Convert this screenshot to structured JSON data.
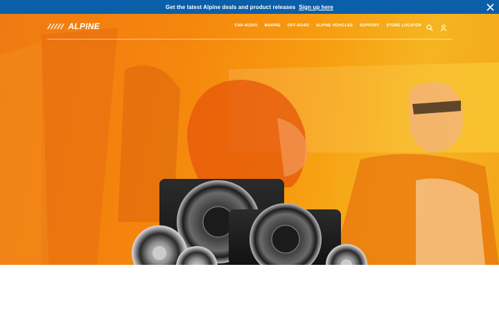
{
  "promo": {
    "text": "Get the latest Alpine deals and product releases",
    "link": "Sign up here",
    "close_icon": "close-icon"
  },
  "brand": {
    "name": "ALPINE",
    "logo": "alpine-logo"
  },
  "nav": {
    "items": [
      {
        "label": "CAR AUDIO"
      },
      {
        "label": "MARINE"
      },
      {
        "label": "OFF-ROAD"
      },
      {
        "label": "ALPINE VEHICLES"
      },
      {
        "label": "SUPPORT"
      },
      {
        "label": "STORE LOCATOR"
      }
    ],
    "search_icon": "search-icon",
    "account_icon": "user-icon"
  },
  "colors": {
    "promo_bg": "#0b5fa8",
    "hero_orange": "#f5860d",
    "hero_yellow": "#f5b520"
  }
}
